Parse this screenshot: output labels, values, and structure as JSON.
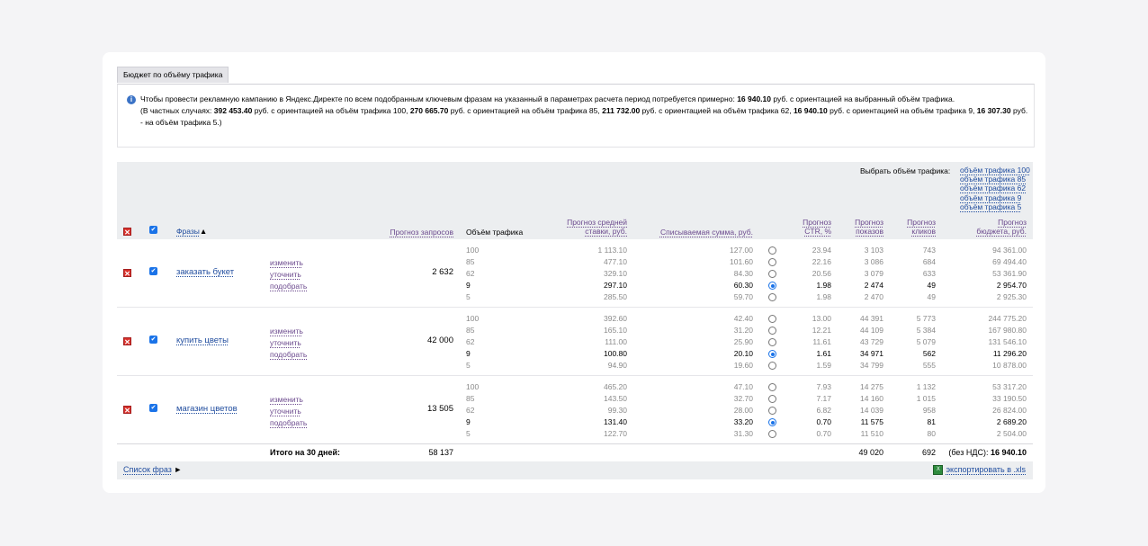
{
  "tab_label": "Бюджет по объёму трафика",
  "info": {
    "p1": "Чтобы провести рекламную кампанию в Яндекс.Директе по всем подобранным ключевым фразам на указанный в параметрах расчета период потребуется примерно: ",
    "b1": "16 940.10",
    "p2": " руб. с ориентацией на выбранный объём трафика.",
    "p3": "(В частных случаях: ",
    "b2": "392 453.40",
    "p4": " руб. с ориентацией на объём трафика 100, ",
    "b3": "270 665.70",
    "p5": " руб. с ориентацией на объём трафика 85, ",
    "b4": "211 732.00",
    "p6": " руб. с ориентацией на объём трафика 62, ",
    "b5": "16 940.10",
    "p7": " руб. с ориентацией на объём трафика 9, ",
    "b6": "16 307.30",
    "p8": " руб. - на объём трафика 5.)"
  },
  "select_traffic": {
    "label": "Выбрать объём трафика:",
    "options": [
      "объём трафика 100",
      "объём трафика 85",
      "объём трафика 62",
      "объём трафика 9",
      "объём трафика 5"
    ]
  },
  "columns": {
    "phrases": "Фразы",
    "sort_arrow": "▲",
    "requests": "Прогноз запросов",
    "traffic": "Объём трафика",
    "bid_l1": "Прогноз средней",
    "bid_l2": "ставки, руб.",
    "charge": "Списываемая сумма, руб.",
    "ctr_l1": "Прогноз",
    "ctr_l2": "CTR, %",
    "shows_l1": "Прогноз",
    "shows_l2": "показов",
    "clicks_l1": "Прогноз",
    "clicks_l2": "кликов",
    "budget_l1": "Прогноз",
    "budget_l2": "бюджета, руб."
  },
  "actions": {
    "change": "изменить",
    "refine": "уточнить",
    "pick": "подобрать"
  },
  "rows": [
    {
      "phrase": "заказать букет",
      "requests": "2 632",
      "levels": [
        "100",
        "85",
        "62",
        "9",
        "5"
      ],
      "bids": [
        "1 113.10",
        "477.10",
        "329.10",
        "297.10",
        "285.50"
      ],
      "charges": [
        "127.00",
        "101.60",
        "84.30",
        "60.30",
        "59.70"
      ],
      "selected": 3,
      "ctr": [
        "23.94",
        "22.16",
        "20.56",
        "1.98",
        "1.98"
      ],
      "shows": [
        "3 103",
        "3 086",
        "3 079",
        "2 474",
        "2 470"
      ],
      "clicks": [
        "743",
        "684",
        "633",
        "49",
        "49"
      ],
      "budget": [
        "94 361.00",
        "69 494.40",
        "53 361.90",
        "2 954.70",
        "2 925.30"
      ]
    },
    {
      "phrase": "купить цветы",
      "requests": "42 000",
      "levels": [
        "100",
        "85",
        "62",
        "9",
        "5"
      ],
      "bids": [
        "392.60",
        "165.10",
        "111.00",
        "100.80",
        "94.90"
      ],
      "charges": [
        "42.40",
        "31.20",
        "25.90",
        "20.10",
        "19.60"
      ],
      "selected": 3,
      "ctr": [
        "13.00",
        "12.21",
        "11.61",
        "1.61",
        "1.59"
      ],
      "shows": [
        "44 391",
        "44 109",
        "43 729",
        "34 971",
        "34 799"
      ],
      "clicks": [
        "5 773",
        "5 384",
        "5 079",
        "562",
        "555"
      ],
      "budget": [
        "244 775.20",
        "167 980.80",
        "131 546.10",
        "11 296.20",
        "10 878.00"
      ]
    },
    {
      "phrase": "магазин цветов",
      "requests": "13 505",
      "levels": [
        "100",
        "85",
        "62",
        "9",
        "5"
      ],
      "bids": [
        "465.20",
        "143.50",
        "99.30",
        "131.40",
        "122.70"
      ],
      "charges": [
        "47.10",
        "32.70",
        "28.00",
        "33.20",
        "31.30"
      ],
      "selected": 3,
      "ctr": [
        "7.93",
        "7.17",
        "6.82",
        "0.70",
        "0.70"
      ],
      "shows": [
        "14 275",
        "14 160",
        "14 039",
        "11 575",
        "11 510"
      ],
      "clicks": [
        "1 132",
        "1 015",
        "958",
        "81",
        "80"
      ],
      "budget": [
        "53 317.20",
        "33 190.50",
        "26 824.00",
        "2 689.20",
        "2 504.00"
      ]
    }
  ],
  "totals": {
    "label": "Итого на 30 дней:",
    "requests": "58 137",
    "shows": "49 020",
    "clicks": "692",
    "budget_prefix": "(без НДС): ",
    "budget": "16 940.10"
  },
  "footer": {
    "phrase_list": "Список фраз",
    "phrase_list_arrow": "►",
    "export": "экспортировать в .xls"
  },
  "colors": {
    "link": "#1f4c9e",
    "visited_link": "#6c4a8e",
    "header_bg": "#eceef0",
    "checkbox": "#1a73e8",
    "delete": "#d9312b"
  }
}
